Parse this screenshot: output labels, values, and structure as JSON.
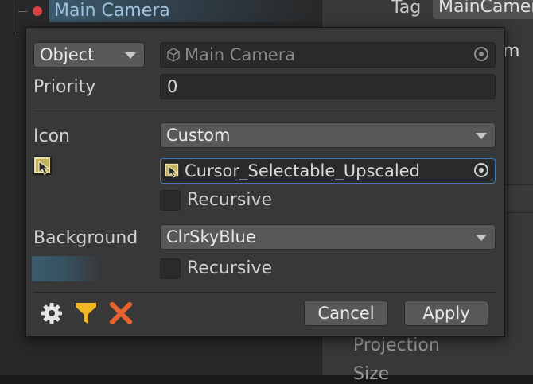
{
  "hierarchy": {
    "selected_item": "Main Camera",
    "status_color": "#d84141"
  },
  "inspector_background": {
    "tag_label": "Tag",
    "tag_value": "MainCamera",
    "partial_text": "m",
    "projection_label": "Projection",
    "size_label": "Size"
  },
  "popup": {
    "mode_dropdown": "Object",
    "object_field": "Main Camera",
    "priority_label": "Priority",
    "priority_value": "0",
    "icon_label": "Icon",
    "icon_dropdown": "Custom",
    "icon_field": "Cursor_Selectable_Upscaled",
    "icon_recursive_label": "Recursive",
    "background_label": "Background",
    "background_dropdown": "ClrSkyBlue",
    "background_recursive_label": "Recursive",
    "cancel_label": "Cancel",
    "apply_label": "Apply",
    "colors": {
      "focus_border": "#3a79bb",
      "gear": "#e6e6e6",
      "filter": "#f2b824",
      "clear": "#e8622d"
    },
    "icons": [
      "gear-icon",
      "filter-icon",
      "clear-x-icon",
      "cursor-icon",
      "cube-icon",
      "object-picker-icon"
    ]
  }
}
